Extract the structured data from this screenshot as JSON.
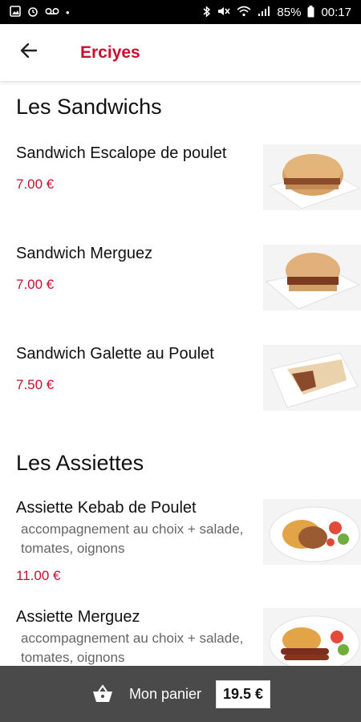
{
  "status_bar": {
    "battery": "85%",
    "time": "00:17",
    "icons": [
      "image-icon",
      "alarm-icon",
      "voicemail-icon",
      "dot-icon",
      "bluetooth-icon",
      "mute-icon",
      "wifi-icon",
      "signal-icon",
      "battery-icon"
    ]
  },
  "header": {
    "title": "Erciyes",
    "back_icon": "arrow-left-icon",
    "accent_color": "#c8102e"
  },
  "sections": [
    {
      "title": "Les Sandwichs",
      "items": [
        {
          "name": "Sandwich Escalope de poulet",
          "price": "7.00 €"
        },
        {
          "name": "Sandwich Merguez",
          "price": "7.00 €"
        },
        {
          "name": "Sandwich Galette au Poulet",
          "price": "7.50 €"
        }
      ]
    },
    {
      "title": "Les Assiettes",
      "items": [
        {
          "name": "Assiette Kebab de Poulet",
          "description": "accompagnement au choix + salade, tomates, oignons",
          "price": "11.00 €"
        },
        {
          "name": "Assiette Merguez",
          "description": "accompagnement au choix + salade, tomates, oignons"
        }
      ]
    }
  ],
  "cart": {
    "label": "Mon panier",
    "total": "19.5 €",
    "icon": "basket-icon",
    "bar_color": "#4a4a4a"
  }
}
